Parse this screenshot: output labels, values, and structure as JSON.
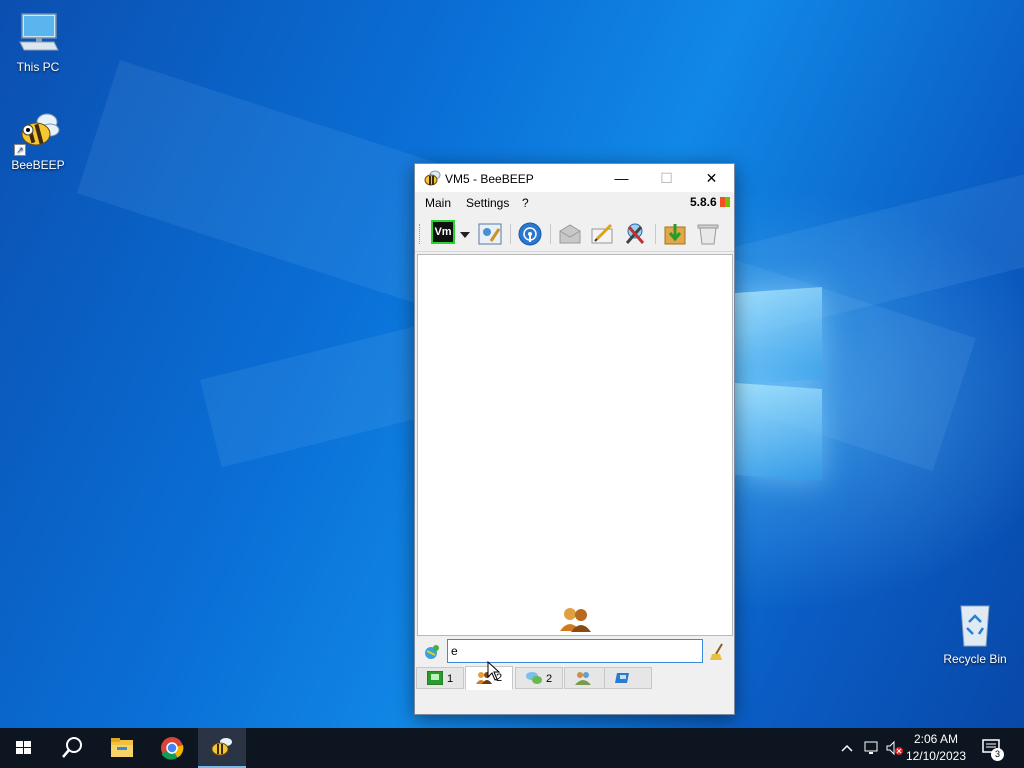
{
  "desktop": {
    "icons": [
      {
        "label": "This PC"
      },
      {
        "label": "BeeBEEP"
      },
      {
        "label": "Recycle Bin"
      }
    ]
  },
  "window": {
    "title": "VM5 - BeeBEEP",
    "controls": {
      "minimize": "—",
      "maximize": "☐",
      "close": "✕"
    },
    "menu": [
      "Main",
      "Settings",
      "?"
    ],
    "version": "5.8.6",
    "toolbar": {
      "user_badge": "Vm",
      "items": [
        "user-status",
        "edit-profile",
        "network",
        "mail",
        "write-message",
        "tools",
        "download",
        "trash"
      ]
    },
    "message_input": {
      "value": "e"
    },
    "tabs": [
      {
        "icon": "users-online-icon",
        "label": "1"
      },
      {
        "icon": "users-icon",
        "label": "2"
      },
      {
        "icon": "chats-icon",
        "label": "2"
      },
      {
        "icon": "groups-icon",
        "label": ""
      },
      {
        "icon": "network-icon",
        "label": ""
      }
    ]
  },
  "taskbar": {
    "clock_time": "2:06 AM",
    "clock_date": "12/10/2023",
    "notification_count": "3"
  },
  "colors": {
    "accent": "#0a66c8",
    "taskbar": "#0d1520",
    "input_border": "#3c8ae0"
  }
}
